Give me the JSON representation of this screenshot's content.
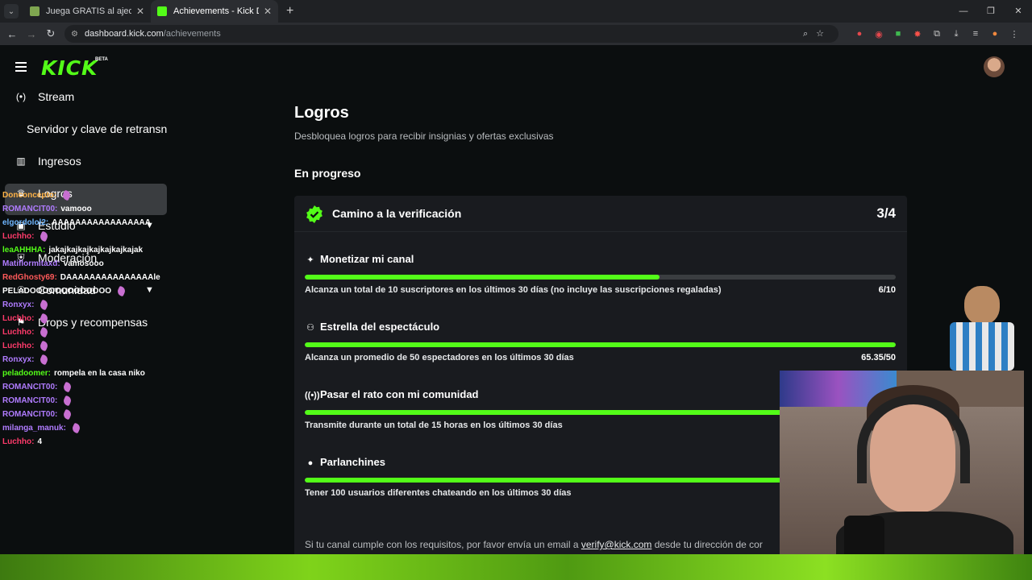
{
  "browser": {
    "tabs": [
      {
        "title": "Juega GRATIS al ajedrez online",
        "color": "#7fa650"
      },
      {
        "title": "Achievements - Kick Dashboard",
        "color": "#53fc18"
      }
    ],
    "url_domain": "dashboard.kick.com",
    "url_path": "/achievements"
  },
  "header": {
    "logo": "KICK",
    "beta": "BETA"
  },
  "sidebar": {
    "items": [
      {
        "label": "Stream",
        "icon": "broadcast-icon"
      },
      {
        "label": "Servidor y clave de retransn",
        "icon": ""
      },
      {
        "label": "Ingresos",
        "icon": "chart-icon"
      },
      {
        "label": "Logros",
        "icon": "trophy-icon"
      },
      {
        "label": "Estudio",
        "icon": "studio-icon"
      },
      {
        "label": "Moderación",
        "icon": "shield-icon"
      },
      {
        "label": "Comunidad",
        "icon": "people-icon"
      },
      {
        "label": "Drops y recompensas",
        "icon": "gift-icon"
      }
    ]
  },
  "chat": [
    {
      "user": "Donconcepto:",
      "msg": "",
      "color": "#ffb347"
    },
    {
      "user": "ROMANCIT00:",
      "msg": "vamooo",
      "color": "#b07cff"
    },
    {
      "user": "elgordolol2:",
      "msg": "AAAAAAAAAAAAAAAAA",
      "color": "#6fb6ff"
    },
    {
      "user": "Luchho:",
      "msg": "",
      "color": "#ff3b6b"
    },
    {
      "user": "leaAHHHA:",
      "msg": "jakajkajkajkajkajkajkajak",
      "color": "#53fc18"
    },
    {
      "user": "Matiflormitaxd:",
      "msg": "vamosooo",
      "color": "#b07cff"
    },
    {
      "user": "RedGhosty69:",
      "msg": "DAAAAAAAAAAAAAAAle",
      "color": "#ff5a5a"
    },
    {
      "user": "PELADOOOOOOOOOOOOO",
      "msg": "",
      "color": "#ffffff"
    },
    {
      "user": "Ronxyx:",
      "msg": "",
      "color": "#b07cff"
    },
    {
      "user": "Luchho:",
      "msg": "",
      "color": "#ff3b6b"
    },
    {
      "user": "Luchho:",
      "msg": "",
      "color": "#ff3b6b"
    },
    {
      "user": "Luchho:",
      "msg": "",
      "color": "#ff3b6b"
    },
    {
      "user": "Ronxyx:",
      "msg": "",
      "color": "#b07cff"
    },
    {
      "user": "peladoomer:",
      "msg": "rompela en la casa niko",
      "color": "#53fc18"
    },
    {
      "user": "ROMANCIT00:",
      "msg": "",
      "color": "#b07cff"
    },
    {
      "user": "ROMANCIT00:",
      "msg": "",
      "color": "#b07cff"
    },
    {
      "user": "ROMANCIT00:",
      "msg": "",
      "color": "#b07cff"
    },
    {
      "user": "milanga_manuk:",
      "msg": "",
      "color": "#b07cff"
    },
    {
      "user": "Luchho:",
      "msg": "4",
      "color": "#ff3b6b"
    }
  ],
  "main": {
    "title": "Logros",
    "subtitle": "Desbloquea logros para recibir insignias y ofertas exclusivas",
    "section": "En progreso",
    "card": {
      "title": "Camino a la verificación",
      "progress": "3/4",
      "tasks": [
        {
          "title": "Monetizar mi canal",
          "icon": "sparkle-icon",
          "desc": "Alcanza un total de 10 suscriptores en los últimos 30 días (no incluye las suscripciones regaladas)",
          "count": "6/10",
          "fill": 0.6
        },
        {
          "title": "Estrella del espectáculo",
          "icon": "viewers-icon",
          "desc": "Alcanza un promedio de 50 espectadores en los últimos 30 días",
          "count": "65.35/50",
          "fill": 1.0
        },
        {
          "title": "Pasar el rato con mi comunidad",
          "icon": "broadcast-icon",
          "desc": "Transmite durante un total de 15 horas en los últimos 30 días",
          "count": "",
          "fill": 1.0
        },
        {
          "title": "Parlanchines",
          "icon": "chat-icon",
          "desc": "Tener 100 usuarios diferentes chateando en los últimos 30 días",
          "count": "",
          "fill": 1.0
        }
      ],
      "footer_pre": "Si tu canal cumple con los requisitos, por favor envía un email a",
      "footer_link": "verify@kick.com",
      "footer_post": "desde tu dirección de cor"
    }
  },
  "colors": {
    "accent": "#53fc18",
    "bg": "#0b0e0f",
    "card": "#191b1f"
  }
}
